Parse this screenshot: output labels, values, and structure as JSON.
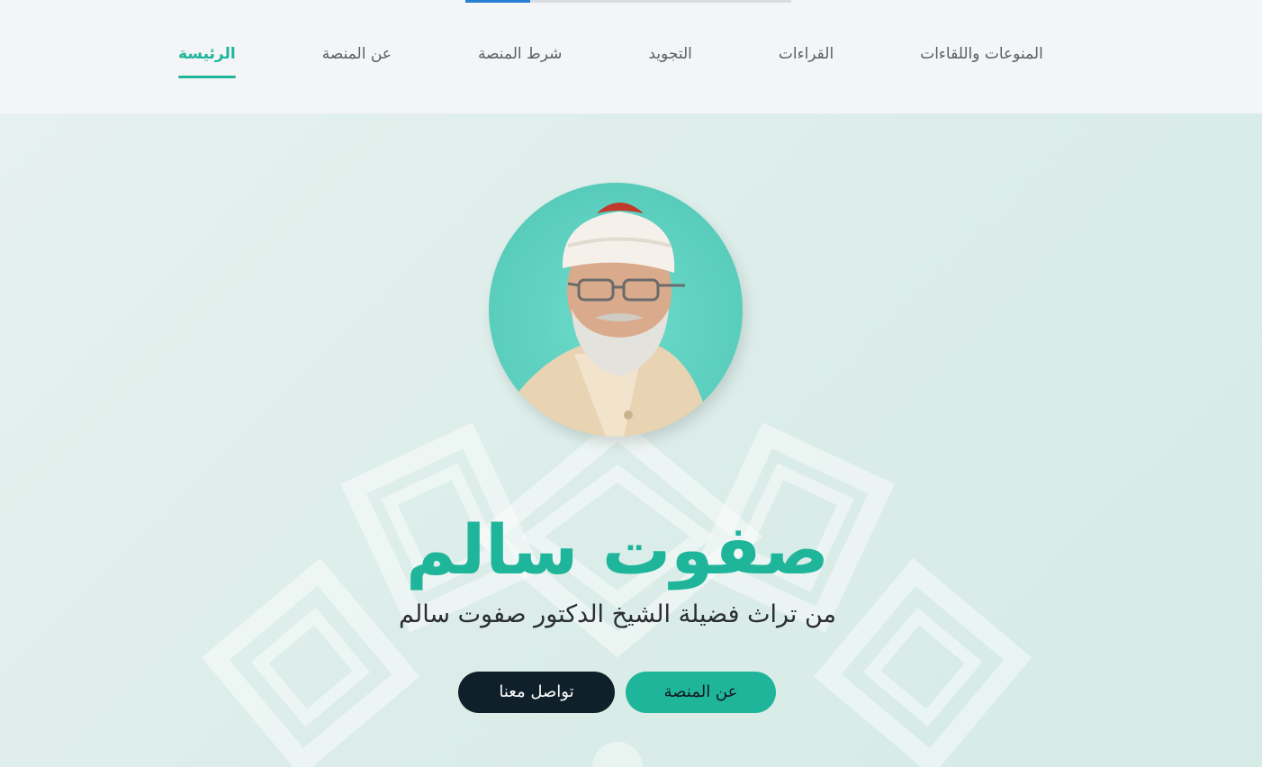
{
  "nav": {
    "items": [
      {
        "label": "الرئيسة",
        "active": true
      },
      {
        "label": "عن المنصة",
        "active": false
      },
      {
        "label": "شرط المنصة",
        "active": false
      },
      {
        "label": "التجويد",
        "active": false
      },
      {
        "label": "القراءات",
        "active": false
      },
      {
        "label": "المنوعات واللقاءات",
        "active": false
      }
    ]
  },
  "hero": {
    "title": "صفوت سالم",
    "subtitle": "من تراث فضيلة الشيخ الدكتور صفوت سالم",
    "buttons": {
      "about": "عن المنصة",
      "contact": "تواصل معنا"
    },
    "portrait_icon": "sheikh-portrait"
  },
  "colors": {
    "accent": "#1fb59a",
    "dark": "#10202b",
    "nav_bg": "#f4f5f7",
    "hero_bg": "#dceeeb",
    "progress": "#2a7fd4"
  },
  "page_scroll_progress": 0.2
}
